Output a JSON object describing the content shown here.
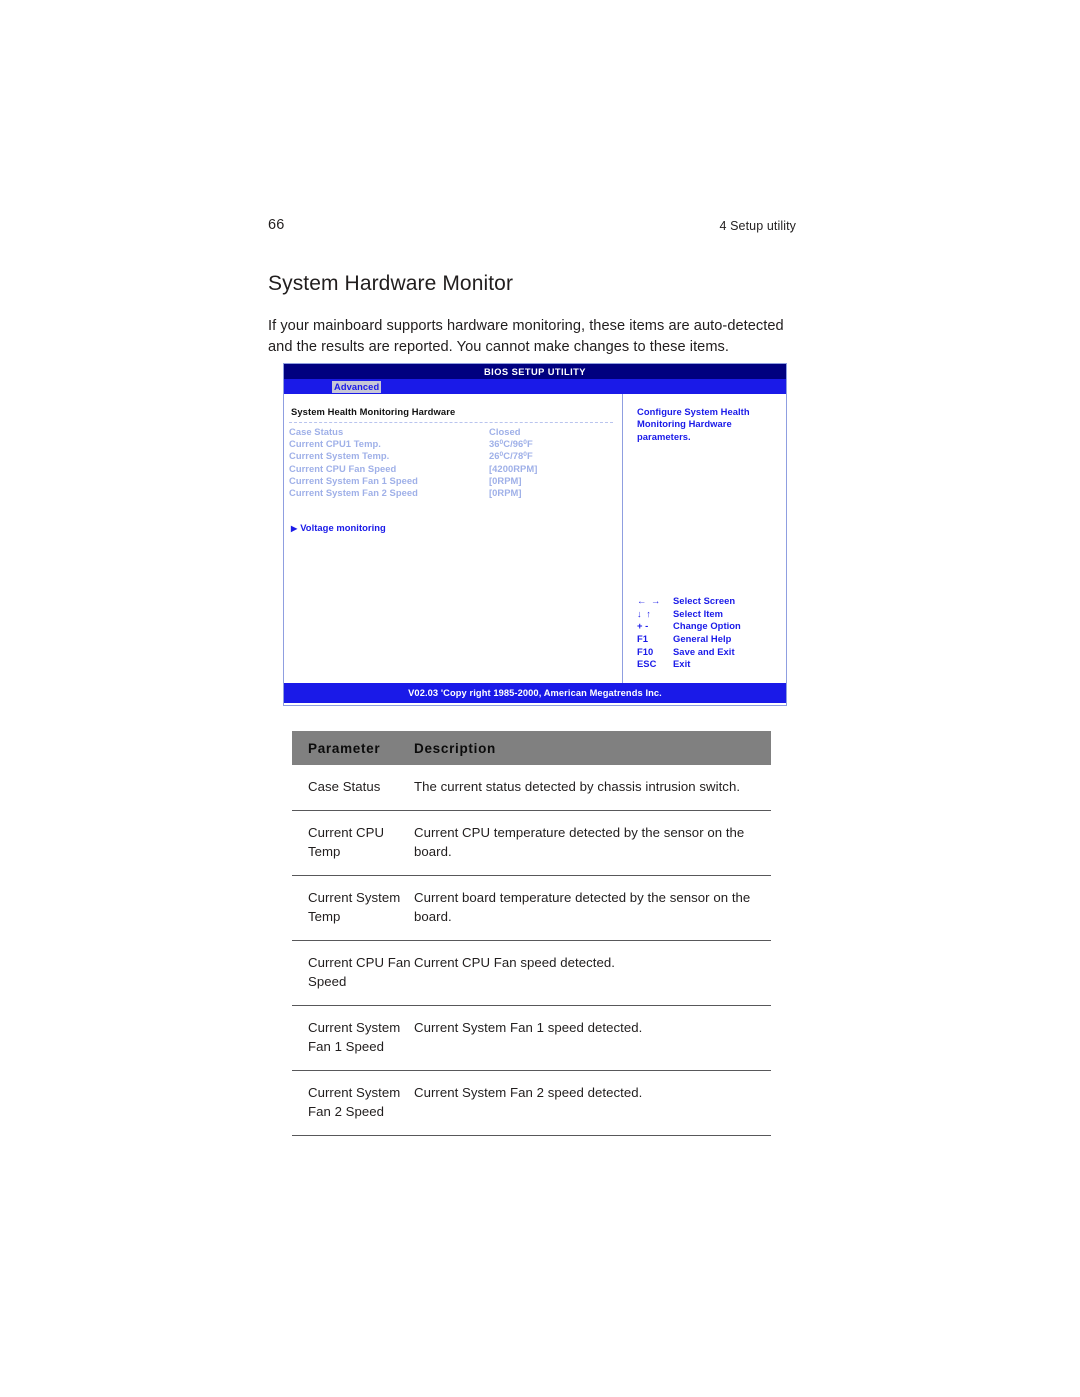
{
  "page": {
    "number": "66",
    "running_head": "4 Setup utility",
    "section_title": "System Hardware Monitor",
    "intro": "If your mainboard supports hardware monitoring, these items are auto-detected and the results are reported. You cannot make changes to these items."
  },
  "bios": {
    "title": "BIOS SETUP UTILITY",
    "menu_selected": "Advanced",
    "section_heading": "System Health Monitoring Hardware",
    "items": [
      {
        "label": "Case Status",
        "value": "Closed",
        "value_parts": null
      },
      {
        "label": "Current CPU1 Temp.",
        "value": "36°C/96°F",
        "value_parts": {
          "a": "36",
          "deg1": "0",
          "mid": "C/96",
          "deg2": "0",
          "tail": "F"
        }
      },
      {
        "label": "Current System Temp.",
        "value": "26°C/78°F",
        "value_parts": {
          "a": "26",
          "deg1": "0",
          "mid": "C/78",
          "deg2": "0",
          "tail": "F"
        }
      },
      {
        "label": "Current CPU Fan Speed",
        "value": "[4200RPM]",
        "value_parts": null
      },
      {
        "label": "Current System Fan 1 Speed",
        "value": "[0RPM]",
        "value_parts": null
      },
      {
        "label": "Current System Fan 2 Speed",
        "value": "[0RPM]",
        "value_parts": null
      }
    ],
    "voltage_link": "Voltage monitoring",
    "voltage_link_marker": "▶",
    "help_text": "Configure System Health Monitoring Hardware parameters.",
    "key_legend": [
      {
        "keys": "← →",
        "action": "Select Screen"
      },
      {
        "keys": "↓ ↑",
        "action": "Select Item"
      },
      {
        "keys": "+ -",
        "action": "Change Option"
      },
      {
        "keys": "F1",
        "action": "General Help"
      },
      {
        "keys": "F10",
        "action": "Save and Exit"
      },
      {
        "keys": "ESC",
        "action": "Exit"
      }
    ],
    "footer": "V02.03 'Copy right 1985-2000, American Megatrends Inc.",
    "colors": {
      "titlebar": "#000080",
      "menubar": "#1a1ae8",
      "footer": "#1a1ae8",
      "accent_text": "#1a1ae8",
      "disabled_text": "#9fb0e8",
      "border": "#8f9ee0",
      "menu_highlight_bg": "#c7c7d6"
    }
  },
  "param_table": {
    "headers": {
      "parameter": "Parameter",
      "description": "Description"
    },
    "header_bg": "#808080",
    "rows": [
      {
        "parameter": "Case Status",
        "description": "The current status detected by chassis intrusion switch."
      },
      {
        "parameter": "Current CPU Temp",
        "description": "Current CPU temperature detected by the sensor on the board."
      },
      {
        "parameter": "Current System Temp",
        "description": "Current board temperature detected by the sensor on the board."
      },
      {
        "parameter": "Current CPU Fan Speed",
        "description": "Current CPU Fan speed detected."
      },
      {
        "parameter": "Current System Fan 1 Speed",
        "description": "Current System Fan 1 speed detected."
      },
      {
        "parameter": "Current System Fan 2 Speed",
        "description": "Current System Fan 2 speed detected."
      }
    ]
  }
}
